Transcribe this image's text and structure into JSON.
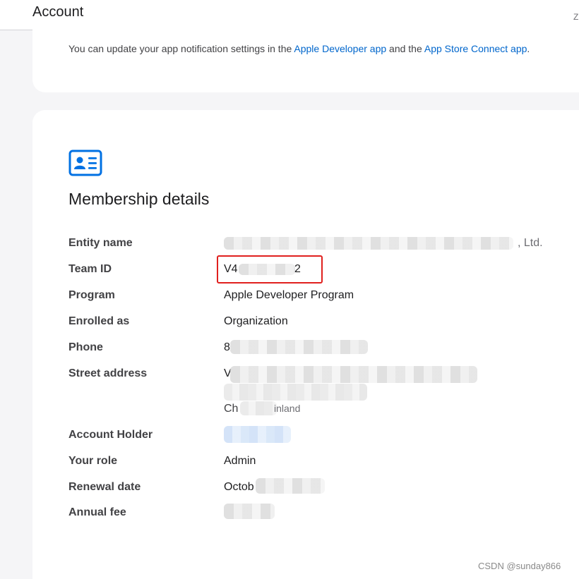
{
  "header": {
    "title": "Account",
    "corner_text": "Z"
  },
  "notifications": {
    "prefix": "You can update your app notification settings in the ",
    "link1": "Apple Developer app",
    "middle": " and the ",
    "link2": "App Store Connect app",
    "suffix": ".",
    "link_color": "#0066cc"
  },
  "membership": {
    "icon": "id-card-icon",
    "icon_color": "#0071e3",
    "title": "Membership details",
    "rows": [
      {
        "label": "Entity name",
        "value": ", Ltd."
      },
      {
        "label": "Team ID",
        "value_start": "V4",
        "value_end": "2"
      },
      {
        "label": "Program",
        "value": "Apple Developer Program"
      },
      {
        "label": "Enrolled as",
        "value": "Organization"
      },
      {
        "label": "Phone",
        "value": "8"
      },
      {
        "label": "Street address",
        "value": "V",
        "value_line3": "Ch",
        "value_line3_end": "inland"
      },
      {
        "label": "Account Holder",
        "value": ""
      },
      {
        "label": "Your role",
        "value": "Admin"
      },
      {
        "label": "Renewal date",
        "value": "Octob"
      },
      {
        "label": "Annual fee",
        "value": ""
      }
    ]
  },
  "annotation": {
    "highlight_color": "#e0201e"
  },
  "watermark": "CSDN @sunday866"
}
